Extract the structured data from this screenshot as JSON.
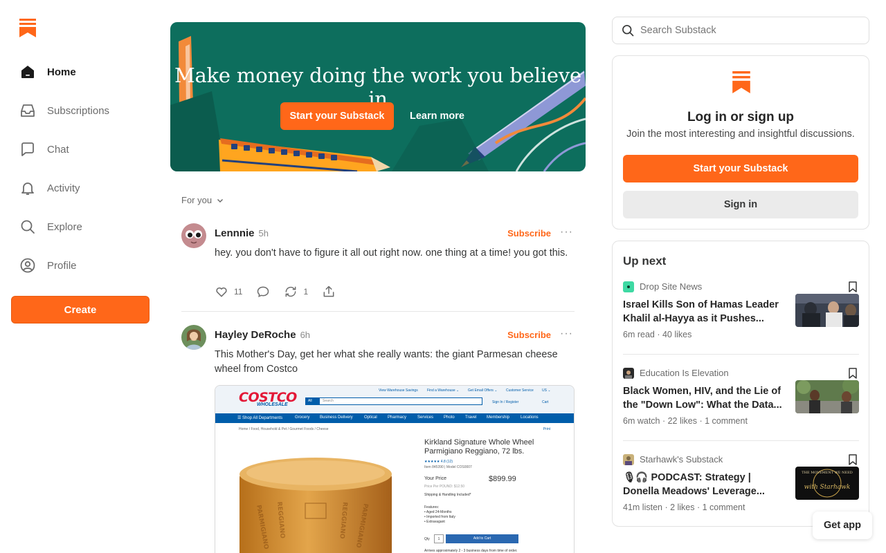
{
  "brand": {
    "accent": "#ff6719",
    "banner_bg": "#0d6e5d"
  },
  "nav": {
    "items": [
      {
        "label": "Home",
        "icon": "home-icon",
        "active": true
      },
      {
        "label": "Subscriptions",
        "icon": "inbox-icon"
      },
      {
        "label": "Chat",
        "icon": "chat-bubble-icon"
      },
      {
        "label": "Activity",
        "icon": "bell-icon"
      },
      {
        "label": "Explore",
        "icon": "search-icon"
      },
      {
        "label": "Profile",
        "icon": "user-circle-icon"
      }
    ],
    "create_label": "Create"
  },
  "banner": {
    "title": "Make money doing the work you believe in",
    "cta_label": "Start your Substack",
    "learn_label": "Learn more"
  },
  "feed": {
    "filter_label": "For you",
    "posts": [
      {
        "author": "Lennnie",
        "time": "5h",
        "subscribe_label": "Subscribe",
        "more_label": "···",
        "body": "hey. you don't have to figure it all out right now. one thing at a time! you got this.",
        "likes": "11",
        "restacks": "1"
      },
      {
        "author": "Hayley DeRoche",
        "time": "6h",
        "subscribe_label": "Subscribe",
        "more_label": "···",
        "body": "This Mother's Day, get her what she really wants: the giant Parmesan cheese wheel from Costco"
      }
    ]
  },
  "costco_shot": {
    "logo": "COSTCO",
    "logo_sub": "WHOLESALE",
    "search_all": "All",
    "search_placeholder": "Search",
    "top_links": [
      "View Warehouse Savings",
      "Find a Warehouse ⌄",
      "Get Email Offers ⌄",
      "Customer Service",
      "US ⌄"
    ],
    "sign_in": "Sign In / Register",
    "cart": "Cart",
    "nav": [
      "☰ Shop All Departments",
      "Grocery",
      "Business Delivery",
      "Optical",
      "Pharmacy",
      "Services",
      "Photo",
      "Travel",
      "Membership",
      "Locations"
    ],
    "breadcrumb": "Home / Food, Household & Pet / Gourmet Foods / Cheese",
    "print": "Print",
    "product_title": "Kirkland Signature Whole Wheel Parmigiano Reggiano, 72 lbs.",
    "rating": "★★★★★ 4.8 (12)",
    "item": "Item 845390 | Model COS0007",
    "your_price": "Your Price",
    "price": "$899.99",
    "price_per": "Price Per POUND: $12.50",
    "shipping": "Shipping & Handling Included*",
    "features": "Features:\n• Aged 24-Months\n• Imported from Italy\n• Extravagant",
    "qty": "Qty",
    "qty_value": "1",
    "add_to_cart": "Add to Cart",
    "arrives": "Arrives approximately 2 - 3 business days from time of order."
  },
  "search": {
    "placeholder": "Search Substack"
  },
  "login": {
    "title": "Log in or sign up",
    "subtitle": "Join the most interesting and insightful discussions.",
    "start_label": "Start your Substack",
    "signin_label": "Sign in"
  },
  "up_next": {
    "title": "Up next",
    "items": [
      {
        "publication": "Drop Site News",
        "title": "Israel Kills Son of Hamas Leader Khalil al-Hayya as it Pushes...",
        "meta": "6m read · 40 likes"
      },
      {
        "publication": "Education Is Elevation",
        "title": "Black Women, HIV, and the Lie of the \"Down Low\": What the Data...",
        "meta": "6m watch · 22 likes · 1 comment"
      },
      {
        "publication": "Starhawk's Substack",
        "title": "PODCAST: Strategy | Donella Meadows' Leverage...",
        "meta": "41m listen · 2 likes · 1 comment",
        "thumb_text": "THE MOVEMENT WE NEED with Starhawk"
      }
    ]
  },
  "get_app_label": "Get app"
}
